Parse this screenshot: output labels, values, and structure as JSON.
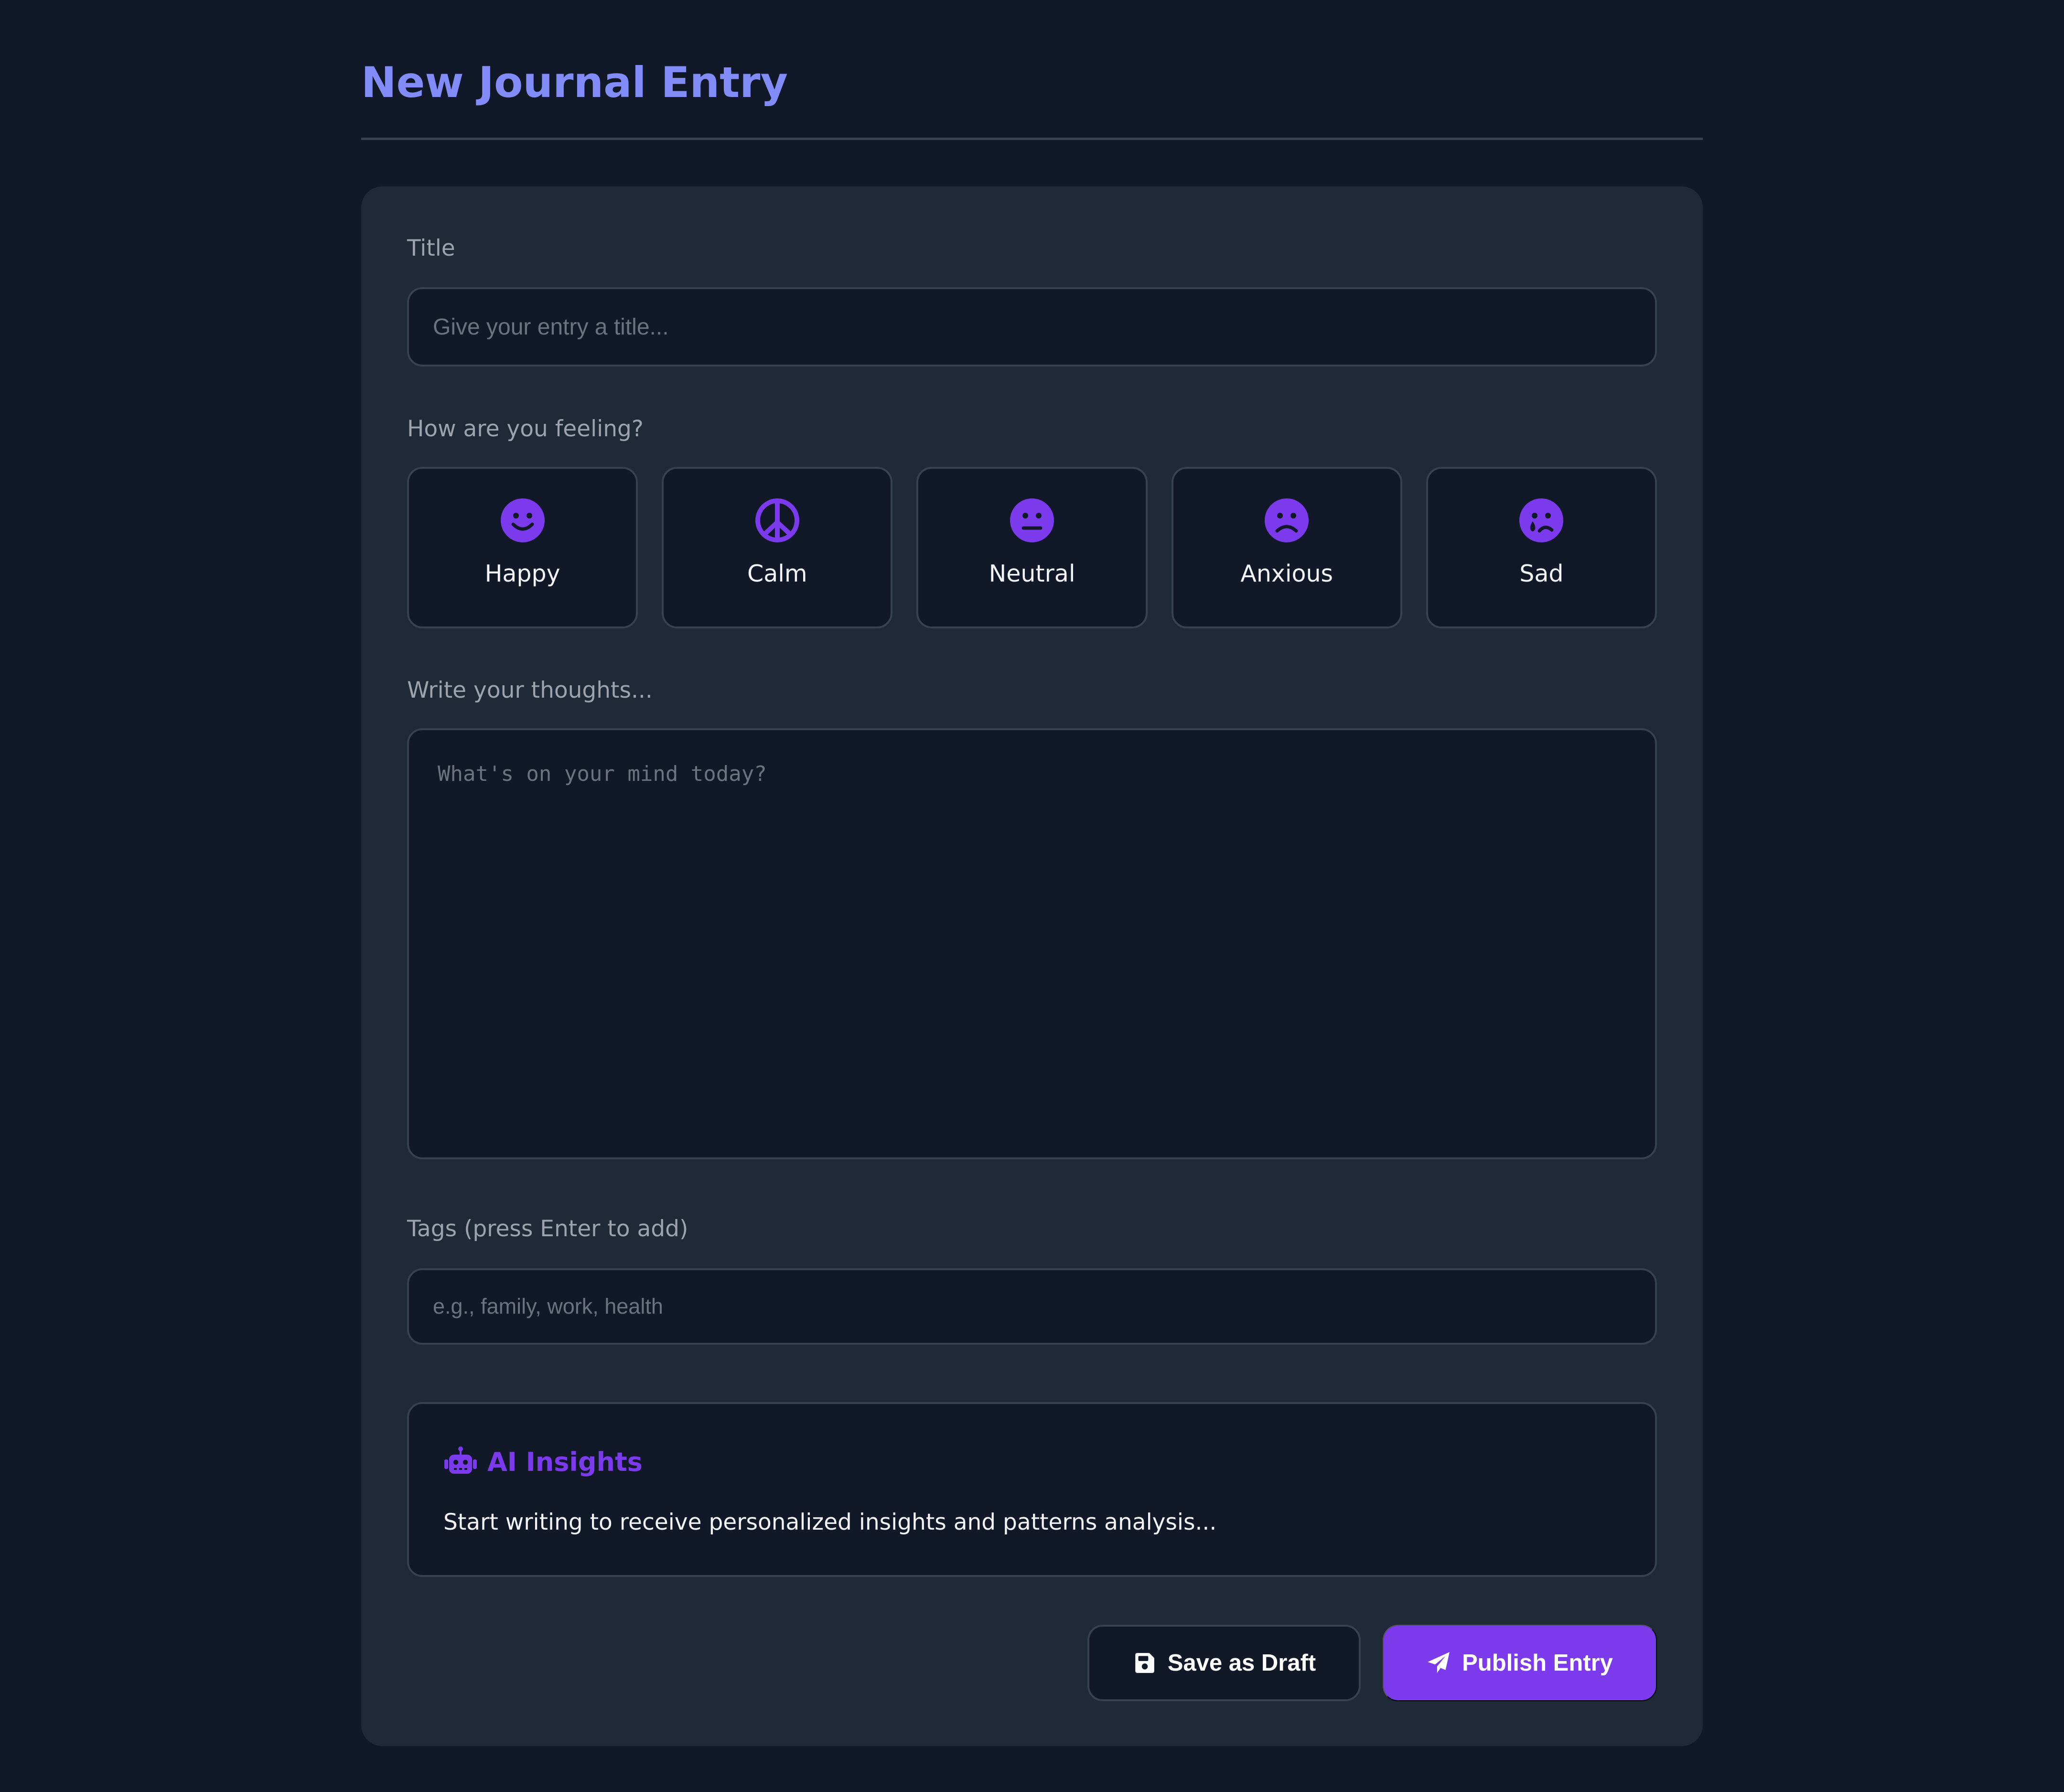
{
  "page": {
    "title": "New Journal Entry"
  },
  "form": {
    "title_label": "Title",
    "title_placeholder": "Give your entry a title...",
    "mood_label": "How are you feeling?",
    "moods": [
      {
        "label": "Happy",
        "icon": "smile-icon"
      },
      {
        "label": "Calm",
        "icon": "peace-icon"
      },
      {
        "label": "Neutral",
        "icon": "meh-icon"
      },
      {
        "label": "Anxious",
        "icon": "frown-icon"
      },
      {
        "label": "Sad",
        "icon": "sad-tear-icon"
      }
    ],
    "thoughts_label": "Write your thoughts...",
    "thoughts_placeholder": "What's on your mind today?",
    "tags_label": "Tags (press Enter to add)",
    "tags_placeholder": "e.g., family, work, health"
  },
  "insights": {
    "icon": "robot-icon",
    "title": "AI Insights",
    "text": "Start writing to receive personalized insights and patterns analysis..."
  },
  "actions": {
    "draft_label": "Save as Draft",
    "draft_icon": "save-icon",
    "publish_label": "Publish Entry",
    "publish_icon": "paper-plane-icon"
  },
  "colors": {
    "background": "#111827",
    "card": "#1f2937",
    "accent": "#7c3aed",
    "heading": "#818cf8",
    "border": "#374151"
  }
}
